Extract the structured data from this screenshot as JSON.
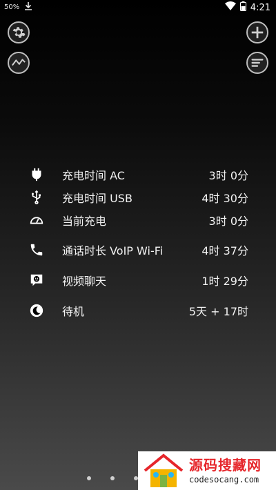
{
  "status_bar": {
    "battery": "50%",
    "time": "4:21"
  },
  "stats": [
    {
      "icon": "plug-icon",
      "label": "充电时间 AC",
      "value": "3时 0分"
    },
    {
      "icon": "usb-icon",
      "label": "充电时间 USB",
      "value": "4时 30分"
    },
    {
      "icon": "speedometer-icon",
      "label": "当前充电",
      "value": "3时 0分"
    },
    {
      "icon": "phone-icon",
      "label": "通话时长 VoIP Wi-Fi",
      "value": "4时 37分"
    },
    {
      "icon": "video-chat-icon",
      "label": "视频聊天",
      "value": "1时 29分"
    },
    {
      "icon": "moon-clock-icon",
      "label": "待机",
      "value": "5天 + 17时"
    }
  ],
  "pager": {
    "pages": 3,
    "active_index": 2
  },
  "watermark": {
    "title": "源码搜藏网",
    "url": "codesocang.com"
  },
  "colors": {
    "watermark_red": "#e6262b",
    "button_border": "#bdbdbd"
  }
}
